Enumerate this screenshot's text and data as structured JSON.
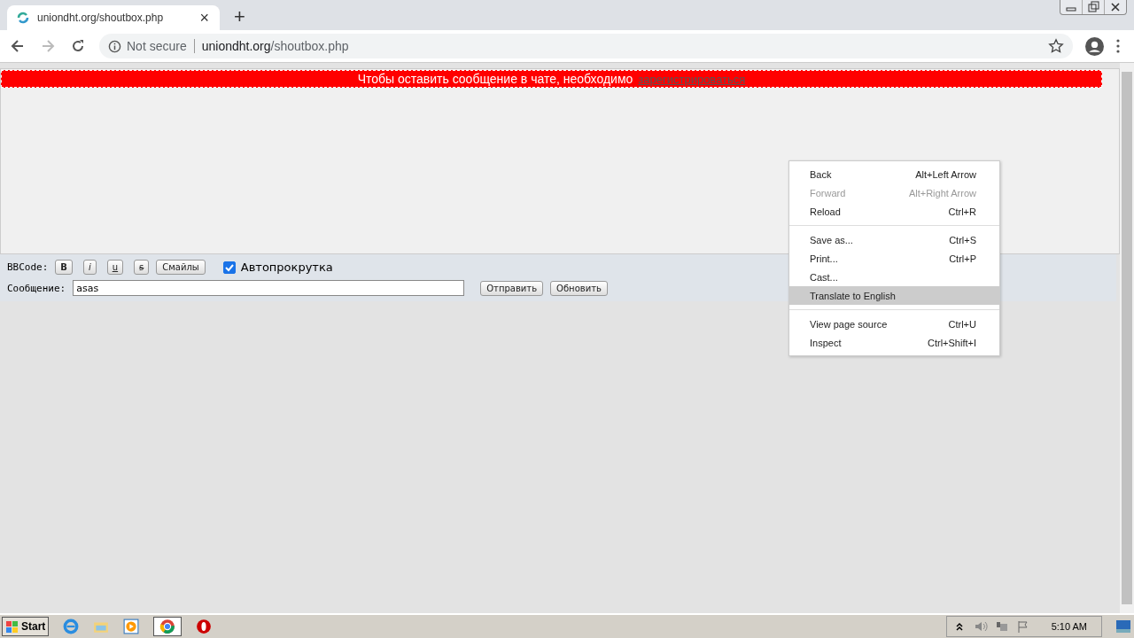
{
  "tab": {
    "title": "uniondht.org/shoutbox.php",
    "close": "×",
    "new_tab": "+"
  },
  "address_bar": {
    "security": "Not secure",
    "domain": "uniondht.org",
    "path": "/shoutbox.php"
  },
  "banner": {
    "text": "Чтобы оставить сообщение в чате, необходимо",
    "link": "зарегистрироваться"
  },
  "toolbar": {
    "label": "BBCode:",
    "format_buttons": [
      "B",
      "i",
      "u",
      "s"
    ],
    "smileys": "Смайлы",
    "autoscroll": {
      "label": "Автопрокрутка",
      "checked": true
    }
  },
  "message": {
    "label": "Сообщение:",
    "value": "asas",
    "buttons": [
      "Отправить",
      "Обновить"
    ]
  },
  "context_menu": {
    "groups": [
      [
        {
          "label": "Back",
          "shortcut": "Alt+Left Arrow",
          "disabled": false,
          "selected": false
        },
        {
          "label": "Forward",
          "shortcut": "Alt+Right Arrow",
          "disabled": true,
          "selected": false
        },
        {
          "label": "Reload",
          "shortcut": "Ctrl+R",
          "disabled": false,
          "selected": false
        }
      ],
      [
        {
          "label": "Save as...",
          "shortcut": "Ctrl+S",
          "disabled": false,
          "selected": false
        },
        {
          "label": "Print...",
          "shortcut": "Ctrl+P",
          "disabled": false,
          "selected": false
        },
        {
          "label": "Cast...",
          "disabled": false,
          "selected": false
        },
        {
          "label": "Translate to English",
          "disabled": false,
          "selected": true
        }
      ],
      [
        {
          "label": "View page source",
          "shortcut": "Ctrl+U",
          "disabled": false,
          "selected": false
        },
        {
          "label": "Inspect",
          "shortcut": "Ctrl+Shift+I",
          "disabled": false,
          "selected": false
        }
      ]
    ]
  },
  "taskbar": {
    "start": "Start",
    "clock": "5:10 AM"
  }
}
